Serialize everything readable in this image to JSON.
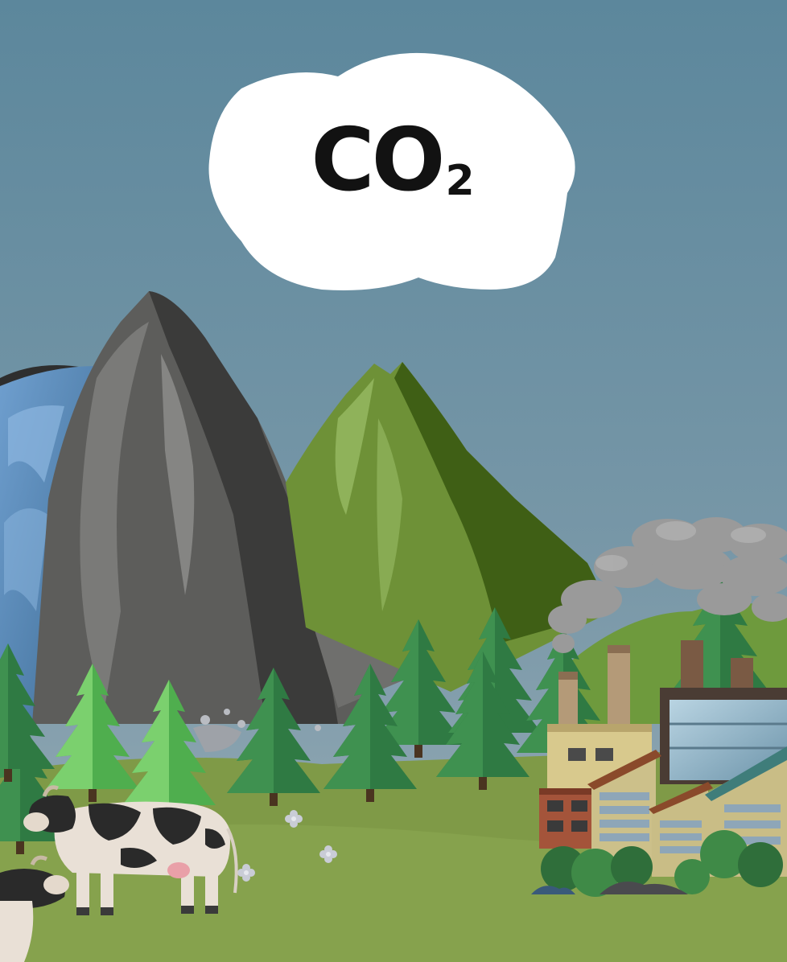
{
  "cloud": {
    "text": "CO",
    "subscript": "2"
  },
  "colors": {
    "sky_top": "#5c879c",
    "sky_bottom": "#93a9b4",
    "grass": "#7f9a47",
    "rock_mountain": "#5d5d5b",
    "green_mountain": "#5e8a2a",
    "water": "#4f7fa8",
    "tree": "#2f7a43",
    "light_tree": "#5bbf54",
    "smoke": "#9a9a9a",
    "factory_wall": "#d2c28a",
    "factory_roof": "#8a4a2b"
  },
  "icons": [
    "co2-cloud-icon",
    "mountain-icon",
    "pine-tree-icon",
    "cow-icon",
    "factory-icon",
    "smoke-icon",
    "flower-icon"
  ]
}
